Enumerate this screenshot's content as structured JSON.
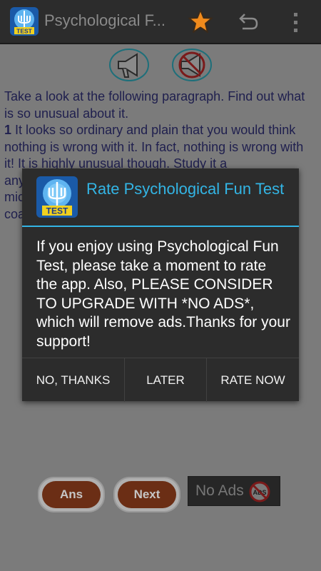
{
  "actionbar": {
    "title": "Psychological F...",
    "icon_text": "TEST",
    "icons": [
      "app-icon",
      "star-icon",
      "undo-icon",
      "overflow-menu-icon"
    ]
  },
  "content": {
    "paragraph_intro": "Take a look at the following paragraph. Find out what is so unusual about it.",
    "paragraph_number": "1",
    "paragraph_body": "It looks so ordinary and plain that you would think nothing is wrong with it. In fact, nothing is wrong with it! It is highly unusual though. Study it a",
    "paragraph_line_any": "any",
    "paragraph_line_mic": "mic",
    "paragraph_line_coa": "coa",
    "buttons": {
      "answer": "Ans",
      "next": "Next"
    },
    "no_ads_label": "No Ads",
    "no_ads_badge": "ADS",
    "icons": [
      "speaker-icon",
      "speaker-muted-icon"
    ]
  },
  "dialog": {
    "title": "Rate Psychological Fun Test",
    "message": "If you enjoy using Psychological Fun Test, please take a moment to rate the app. Also, PLEASE CONSIDER TO UPGRADE WITH *NO ADS*, which will remove ads.Thanks for your support!",
    "buttons": {
      "no_thanks": "NO, THANKS",
      "later": "LATER",
      "rate_now": "RATE NOW"
    },
    "icon_text": "TEST"
  },
  "colors": {
    "accent": "#33b5e5",
    "dim_background": "#7b7b7b",
    "dialog_background": "#2c2c2c",
    "button_brown": "#6b2e15",
    "star": "#f08a1c"
  }
}
